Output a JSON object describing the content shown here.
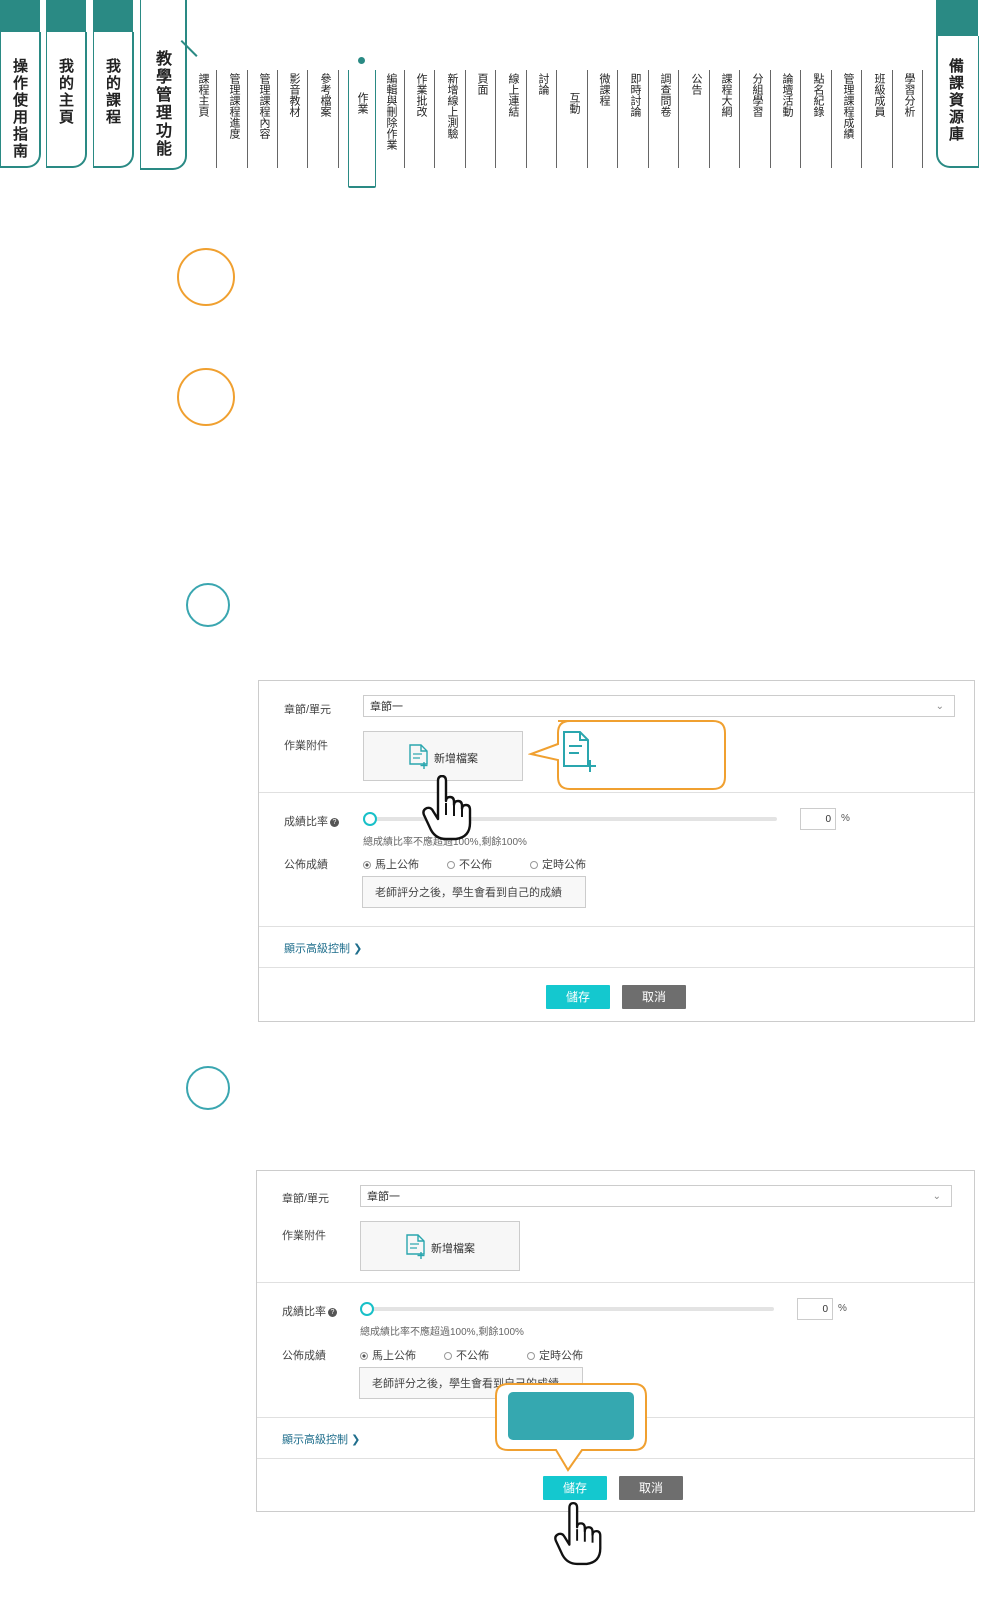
{
  "tabs": {
    "guide": "操作使用指南",
    "home": "我的主頁",
    "courses": "我的課程",
    "teaching": "教學管理功能",
    "resources": "備課資源庫"
  },
  "sub_tabs": [
    "課程主頁",
    "管理課程進度",
    "管理課程內容",
    "影音教材",
    "參考檔案",
    "作業",
    "編輯與刪除作業",
    "作業批改",
    "新增線上測驗",
    "頁面",
    "線上連結",
    "討論",
    "互動",
    "微課程",
    "即時討論",
    "調查問卷",
    "公告",
    "課程大綱",
    "分組學習",
    "論壇活動",
    "點名紀錄",
    "管理課程成績",
    "班級成員",
    "學習分析"
  ],
  "active_sub_tab": "作業",
  "form": {
    "chapter_label": "章節/單元",
    "chapter_value": "章節一",
    "attachment_label": "作業附件",
    "add_file_label": "新增檔案",
    "grade_ratio_label": "成績比率",
    "grade_ratio_value": "0",
    "percent_sign": "%",
    "grade_hint": "總成績比率不應超過100%,剩餘100%",
    "publish_label": "公佈成績",
    "publish_options": [
      "馬上公佈",
      "不公佈",
      "定時公佈"
    ],
    "publish_selected": "馬上公佈",
    "publish_note": "老師評分之後，學生會看到自己的成績",
    "advanced_label": "顯示高級控制",
    "save_label": "儲存",
    "cancel_label": "取消"
  },
  "colors": {
    "teal": "#2a8a84",
    "orange": "#f0a030",
    "cyan_button": "#14c8cf",
    "callout_fill": "#35a8b0"
  }
}
